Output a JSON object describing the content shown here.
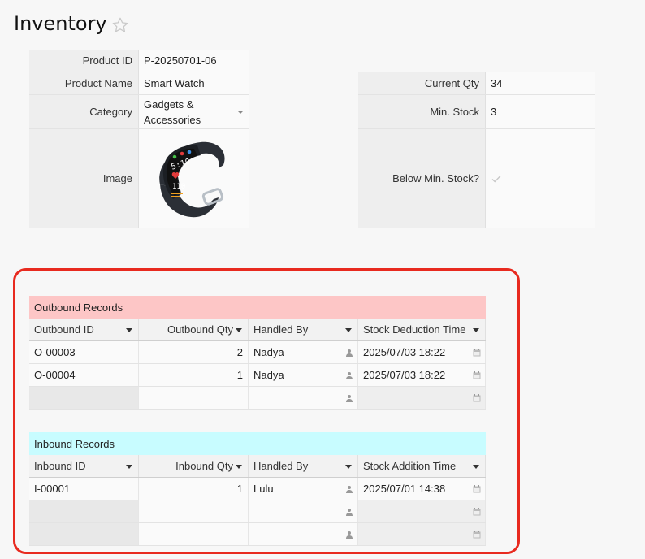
{
  "page": {
    "title": "Inventory"
  },
  "colors": {
    "outbound_header": "#fdc6c6",
    "inbound_header": "#c8fcff",
    "highlight": "#e82a1f"
  },
  "form": {
    "product_id": {
      "label": "Product ID",
      "value": "P-20250701-06"
    },
    "product_name": {
      "label": "Product Name",
      "value": "Smart Watch"
    },
    "category": {
      "label": "Category",
      "value_line1": "Gadgets &",
      "value_line2": "Accessories"
    },
    "image": {
      "label": "Image"
    },
    "current_qty": {
      "label": "Current Qty",
      "value": "34"
    },
    "min_stock": {
      "label": "Min. Stock",
      "value": "3"
    },
    "below_min": {
      "label": "Below Min. Stock?",
      "checked": false
    }
  },
  "outbound": {
    "title": "Outbound Records",
    "headers": [
      "Outbound ID",
      "Outbound Qty",
      "Handled By",
      "Stock Deduction Time"
    ],
    "rows": [
      [
        "O-00003",
        "2",
        "Nadya",
        "2025/07/03 18:22"
      ],
      [
        "O-00004",
        "1",
        "Nadya",
        "2025/07/03 18:22"
      ]
    ]
  },
  "inbound": {
    "title": "Inbound Records",
    "headers": [
      "Inbound ID",
      "Inbound Qty",
      "Handled By",
      "Stock Addition Time"
    ],
    "rows": [
      [
        "I-00001",
        "1",
        "Lulu",
        "2025/07/01 14:38"
      ]
    ]
  }
}
